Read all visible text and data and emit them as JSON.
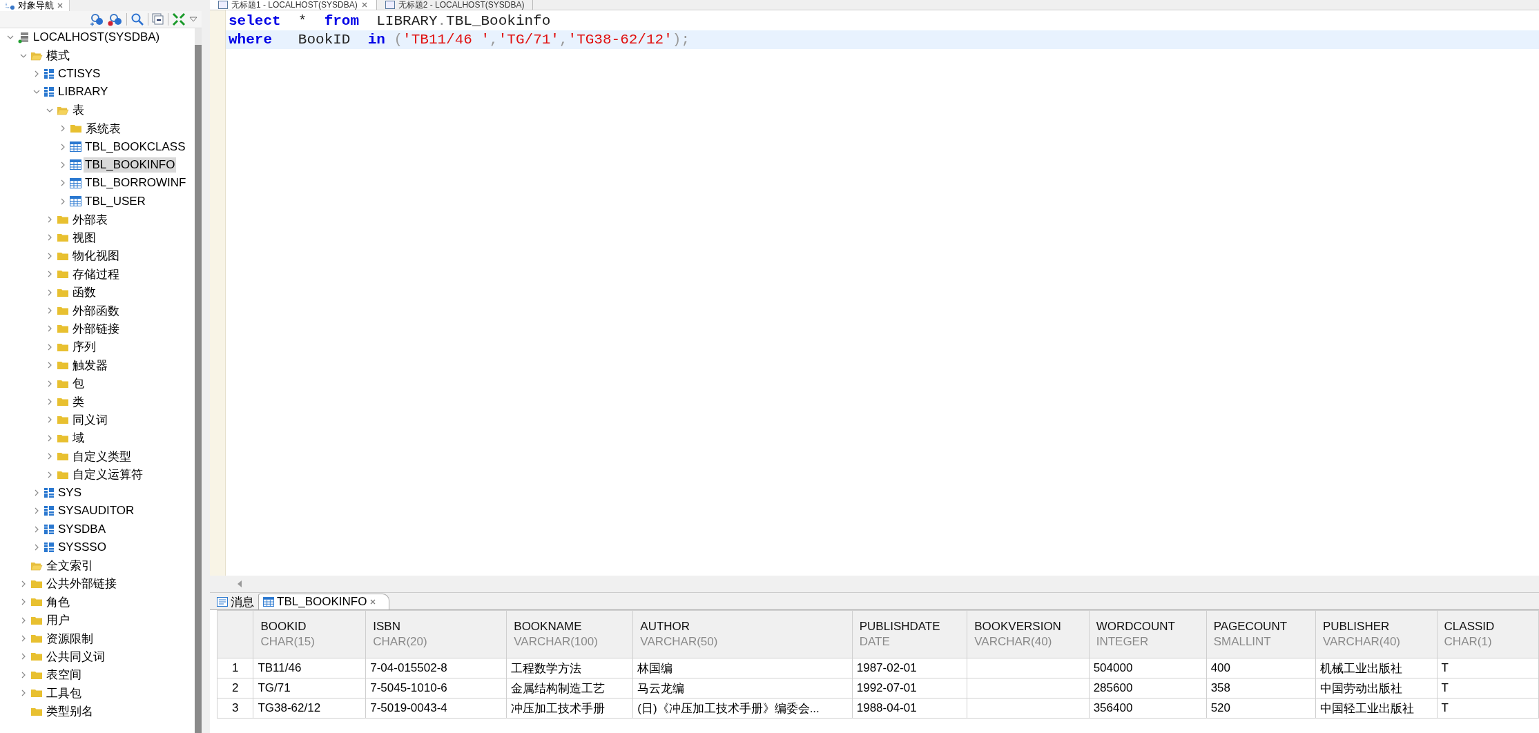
{
  "navigator": {
    "title": "对象导航",
    "tree": [
      {
        "label": "LOCALHOST(SYSDBA)",
        "kind": "server",
        "expandable": true,
        "expanded": true,
        "selected": false,
        "children": [
          {
            "label": "模式",
            "kind": "folder",
            "expandable": true,
            "expanded": true,
            "selected": false,
            "children": [
              {
                "label": "CTISYS",
                "kind": "schema",
                "expandable": true,
                "expanded": false,
                "selected": false
              },
              {
                "label": "LIBRARY",
                "kind": "schema",
                "expandable": true,
                "expanded": true,
                "selected": false,
                "children": [
                  {
                    "label": "表",
                    "kind": "folder",
                    "expandable": true,
                    "expanded": true,
                    "selected": false,
                    "children": [
                      {
                        "label": "系统表",
                        "kind": "folder",
                        "expandable": true,
                        "expanded": false,
                        "selected": false
                      },
                      {
                        "label": "TBL_BOOKCLASS",
                        "kind": "table",
                        "expandable": true,
                        "expanded": false,
                        "selected": false
                      },
                      {
                        "label": "TBL_BOOKINFO",
                        "kind": "table",
                        "expandable": true,
                        "expanded": false,
                        "selected": true
                      },
                      {
                        "label": "TBL_BORROWINF",
                        "kind": "table",
                        "expandable": true,
                        "expanded": false,
                        "selected": false
                      },
                      {
                        "label": "TBL_USER",
                        "kind": "table",
                        "expandable": true,
                        "expanded": false,
                        "selected": false
                      }
                    ]
                  },
                  {
                    "label": "外部表",
                    "kind": "folder",
                    "expandable": true,
                    "expanded": false,
                    "selected": false
                  },
                  {
                    "label": "视图",
                    "kind": "folder",
                    "expandable": true,
                    "expanded": false,
                    "selected": false
                  },
                  {
                    "label": "物化视图",
                    "kind": "folder",
                    "expandable": true,
                    "expanded": false,
                    "selected": false
                  },
                  {
                    "label": "存储过程",
                    "kind": "folder",
                    "expandable": true,
                    "expanded": false,
                    "selected": false
                  },
                  {
                    "label": "函数",
                    "kind": "folder",
                    "expandable": true,
                    "expanded": false,
                    "selected": false
                  },
                  {
                    "label": "外部函数",
                    "kind": "folder",
                    "expandable": true,
                    "expanded": false,
                    "selected": false
                  },
                  {
                    "label": "外部链接",
                    "kind": "folder",
                    "expandable": true,
                    "expanded": false,
                    "selected": false
                  },
                  {
                    "label": "序列",
                    "kind": "folder",
                    "expandable": true,
                    "expanded": false,
                    "selected": false
                  },
                  {
                    "label": "触发器",
                    "kind": "folder",
                    "expandable": true,
                    "expanded": false,
                    "selected": false
                  },
                  {
                    "label": "包",
                    "kind": "folder",
                    "expandable": true,
                    "expanded": false,
                    "selected": false
                  },
                  {
                    "label": "类",
                    "kind": "folder",
                    "expandable": true,
                    "expanded": false,
                    "selected": false
                  },
                  {
                    "label": "同义词",
                    "kind": "folder",
                    "expandable": true,
                    "expanded": false,
                    "selected": false
                  },
                  {
                    "label": "域",
                    "kind": "folder",
                    "expandable": true,
                    "expanded": false,
                    "selected": false
                  },
                  {
                    "label": "自定义类型",
                    "kind": "folder",
                    "expandable": true,
                    "expanded": false,
                    "selected": false
                  },
                  {
                    "label": "自定义运算符",
                    "kind": "folder",
                    "expandable": true,
                    "expanded": false,
                    "selected": false
                  }
                ]
              },
              {
                "label": "SYS",
                "kind": "schema",
                "expandable": true,
                "expanded": false,
                "selected": false
              },
              {
                "label": "SYSAUDITOR",
                "kind": "schema",
                "expandable": true,
                "expanded": false,
                "selected": false
              },
              {
                "label": "SYSDBA",
                "kind": "schema",
                "expandable": true,
                "expanded": false,
                "selected": false
              },
              {
                "label": "SYSSSO",
                "kind": "schema",
                "expandable": true,
                "expanded": false,
                "selected": false
              }
            ]
          },
          {
            "label": "全文索引",
            "kind": "folder",
            "expandable": false,
            "expanded": true,
            "selected": false
          },
          {
            "label": "公共外部链接",
            "kind": "folder",
            "expandable": true,
            "expanded": false,
            "selected": false
          },
          {
            "label": "角色",
            "kind": "folder",
            "expandable": true,
            "expanded": false,
            "selected": false
          },
          {
            "label": "用户",
            "kind": "folder",
            "expandable": true,
            "expanded": false,
            "selected": false
          },
          {
            "label": "资源限制",
            "kind": "folder",
            "expandable": true,
            "expanded": false,
            "selected": false
          },
          {
            "label": "公共同义词",
            "kind": "folder",
            "expandable": true,
            "expanded": false,
            "selected": false
          },
          {
            "label": "表空间",
            "kind": "folder",
            "expandable": true,
            "expanded": false,
            "selected": false
          },
          {
            "label": "工具包",
            "kind": "folder",
            "expandable": true,
            "expanded": false,
            "selected": false
          },
          {
            "label": "类型别名",
            "kind": "folder",
            "expandable": false,
            "expanded": false,
            "selected": false
          }
        ]
      }
    ]
  },
  "editor_tabs": [
    {
      "label": "无标题1 - LOCALHOST(SYSDBA)",
      "selected": true
    },
    {
      "label": "无标题2 - LOCALHOST(SYSDBA)",
      "selected": false
    }
  ],
  "sql_lines": [
    {
      "current": false,
      "tokens": [
        {
          "kind": "keyword",
          "text": "select"
        },
        {
          "kind": "plain",
          "text": "  *  "
        },
        {
          "kind": "keyword",
          "text": "from"
        },
        {
          "kind": "plain",
          "text": "  LIBRARY"
        },
        {
          "kind": "punct",
          "text": "."
        },
        {
          "kind": "plain",
          "text": "TBL_Bookinfo"
        }
      ]
    },
    {
      "current": true,
      "tokens": [
        {
          "kind": "keyword",
          "text": "where"
        },
        {
          "kind": "plain",
          "text": "   BookID  "
        },
        {
          "kind": "keyword",
          "text": "in"
        },
        {
          "kind": "punct",
          "text": " ("
        },
        {
          "kind": "string",
          "text": "'TB11/46 '"
        },
        {
          "kind": "punct",
          "text": ","
        },
        {
          "kind": "string",
          "text": "'TG/71'"
        },
        {
          "kind": "punct",
          "text": ","
        },
        {
          "kind": "string",
          "text": "'TG38-62/12'"
        },
        {
          "kind": "punct",
          "text": ");"
        }
      ]
    }
  ],
  "result_tabs": [
    {
      "label": "消息",
      "kind": "message",
      "selected": false
    },
    {
      "label": "TBL_BOOKINFO",
      "kind": "grid",
      "selected": true
    }
  ],
  "table": {
    "columns": [
      {
        "name": "BOOKID",
        "type": "CHAR(15)"
      },
      {
        "name": "ISBN",
        "type": "CHAR(20)"
      },
      {
        "name": "BOOKNAME",
        "type": "VARCHAR(100)"
      },
      {
        "name": "AUTHOR",
        "type": "VARCHAR(50)"
      },
      {
        "name": "PUBLISHDATE",
        "type": "DATE"
      },
      {
        "name": "BOOKVERSION",
        "type": "VARCHAR(40)"
      },
      {
        "name": "WORDCOUNT",
        "type": "INTEGER"
      },
      {
        "name": "PAGECOUNT",
        "type": "SMALLINT"
      },
      {
        "name": "PUBLISHER",
        "type": "VARCHAR(40)"
      },
      {
        "name": "CLASSID",
        "type": "CHAR(1)"
      }
    ],
    "rows": [
      {
        "number": "1",
        "cells": [
          "TB11/46",
          "7-04-015502-8",
          "工程数学方法",
          "林国编",
          "1987-02-01",
          "",
          "504000",
          "400",
          "机械工业出版社",
          "T"
        ]
      },
      {
        "number": "2",
        "cells": [
          "TG/71",
          "7-5045-1010-6",
          "金属结构制造工艺",
          "马云龙编",
          "1992-07-01",
          "",
          "285600",
          "358",
          "中国劳动出版社",
          "T"
        ]
      },
      {
        "number": "3",
        "cells": [
          "TG38-62/12",
          "7-5019-0043-4",
          "冲压加工技术手册",
          "(日)《冲压加工技术手册》编委会...",
          "1988-04-01",
          "",
          "356400",
          "520",
          "中国轻工业出版社",
          "T"
        ]
      }
    ]
  }
}
